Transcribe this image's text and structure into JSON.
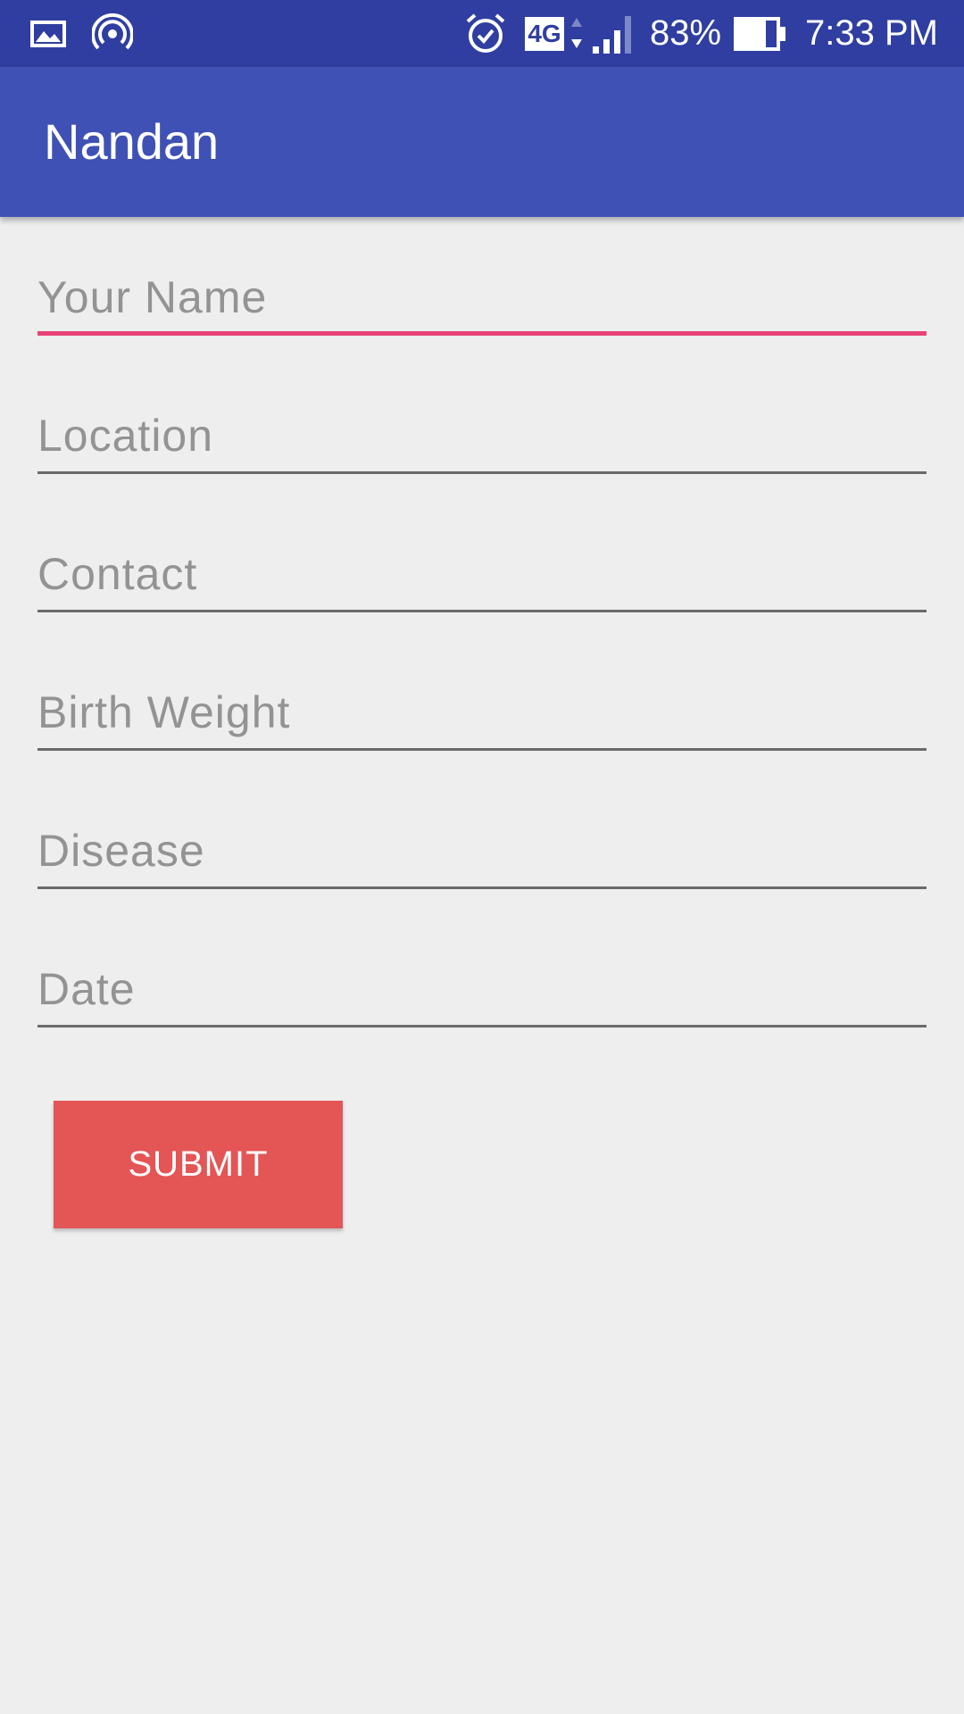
{
  "status_bar": {
    "network": "4G",
    "battery_percent": "83%",
    "time": "7:33 PM",
    "icons": [
      "image-icon",
      "hotspot-icon",
      "alarm-icon",
      "4g-icon",
      "data-arrows-icon",
      "signal-icon",
      "battery-icon"
    ]
  },
  "app_bar": {
    "title": "Nandan"
  },
  "form": {
    "fields": [
      {
        "label": "Your Name"
      },
      {
        "label": "Location"
      },
      {
        "label": "Contact"
      },
      {
        "label": "Birth Weight"
      },
      {
        "label": "Disease"
      },
      {
        "label": "Date"
      }
    ],
    "submit_label": "SUBMIT"
  },
  "colors": {
    "status_bar": "#2f3ea0",
    "app_bar": "#3f51b5",
    "background": "#eeeeef",
    "accent_active_underline": "#e84377",
    "submit_button": "#e45556",
    "hint_text": "#939393"
  }
}
